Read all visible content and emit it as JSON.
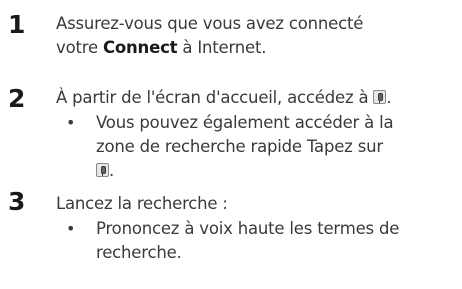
{
  "steps": [
    {
      "number": "1",
      "line1": "Assurez-vous que vous avez connecté",
      "line2_before": "votre ",
      "line2_bold": "Connect",
      "line2_after": " à Internet."
    },
    {
      "number": "2",
      "text_before_icon": "À partir de l'écran d'accueil, accédez à ",
      "text_after_icon": ".",
      "icon": "microphone-icon",
      "bullet": {
        "marker": "•",
        "line1": "Vous pouvez également accéder à la",
        "line2": "zone de recherche rapide Tapez sur",
        "icon": "microphone-icon",
        "line3_after_icon": "."
      }
    },
    {
      "number": "3",
      "text": "Lancez la recherche :",
      "bullet": {
        "marker": "•",
        "line1": "Prononcez à voix haute les termes de",
        "line2": "recherche."
      }
    }
  ]
}
